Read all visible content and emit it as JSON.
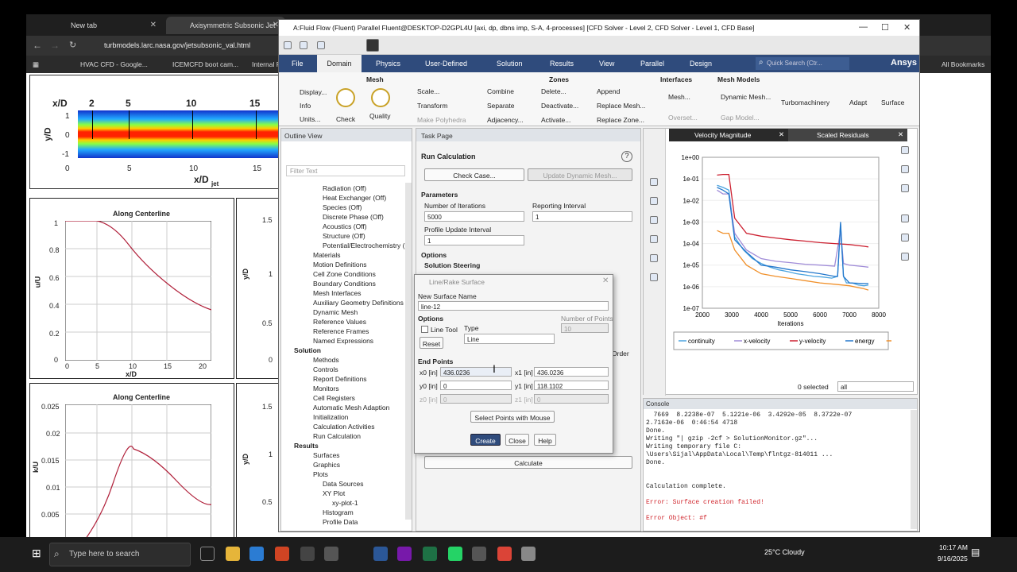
{
  "browser": {
    "tabs": [
      {
        "label": "New tab"
      },
      {
        "label": "Axisymmetric Subsonic Jet"
      }
    ],
    "url": "turbmodels.larc.nasa.gov/jetsubsonic_val.html",
    "bookmarks": [
      "HVAC CFD - Google...",
      "ICEMCFD boot cam...",
      "Internal F",
      "All Bookmarks"
    ]
  },
  "webpage": {
    "contour": {
      "xlabel": "x/D",
      "xsub": "jet",
      "ylabel": "y/D",
      "stations": [
        "x/D",
        "2",
        "5",
        "10",
        "15"
      ],
      "xticks": [
        "0",
        "5",
        "10",
        "15"
      ],
      "yticks": [
        "1",
        "0",
        "-1"
      ]
    },
    "plot1": {
      "title": "Along Centerline",
      "ylabel": "u/U",
      "ysub": "jet",
      "xlabel": "x/D",
      "xsub": "jet",
      "yticks": [
        "1",
        "0.8",
        "0.6",
        "0.4",
        "0.2",
        "0"
      ],
      "xticks": [
        "0",
        "5",
        "10",
        "15",
        "20"
      ]
    },
    "plot2": {
      "title": "Along Centerline",
      "ylabel": "k/U",
      "ysub": "jet",
      "yticks": [
        "0.025",
        "0.02",
        "0.015",
        "0.01",
        "0.005"
      ]
    },
    "plot3": {
      "ylabel": "y/D",
      "yticks": [
        "1.5",
        "1",
        "0.5",
        "0"
      ]
    },
    "plot4": {
      "ylabel": "y/D",
      "yticks": [
        "1.5",
        "1",
        "0.5"
      ]
    }
  },
  "fluent": {
    "title": "A:Fluid Flow (Fluent) Parallel Fluent@DESKTOP-D2GPL4U  [axi, dp, dbns imp, S-A, 4-processes] [CFD Solver - Level 2, CFD Solver - Level 1, CFD Base]",
    "menu": [
      "File",
      "Domain",
      "Physics",
      "User-Defined",
      "Solution",
      "Results",
      "View",
      "Parallel",
      "Design"
    ],
    "quick_search": "Quick Search (Ctr...",
    "brand": "Ansys",
    "ribbon": {
      "mesh_group": "Mesh",
      "zones_group": "Zones",
      "interfaces_group": "Interfaces",
      "mesh_models_group": "Mesh Models",
      "display": "Display...",
      "info": "Info",
      "units": "Units...",
      "check": "Check",
      "quality": "Quality",
      "scale": "Scale...",
      "transform": "Transform",
      "make_polyhedra": "Make Polyhedra",
      "combine": "Combine",
      "separate": "Separate",
      "adjacency": "Adjacency...",
      "delete": "Delete...",
      "deactivate": "Deactivate...",
      "activate": "Activate...",
      "append": "Append",
      "replace_mesh": "Replace Mesh...",
      "replace_zone": "Replace Zone...",
      "mesh_iface": "Mesh...",
      "overset": "Overset...",
      "dynamic_mesh": "Dynamic Mesh...",
      "gap_model": "Gap Model...",
      "turbomachinery": "Turbomachinery",
      "adapt": "Adapt",
      "surface": "Surface"
    },
    "outline": {
      "title": "Outline View",
      "filter": "Filter Text",
      "items": [
        "Radiation (Off)",
        "Heat Exchanger (Off)",
        "Species (Off)",
        "Discrete Phase (Off)",
        "Acoustics (Off)",
        "Structure (Off)",
        "Potential/Electrochemistry (Off)",
        "Materials",
        "Motion Definitions",
        "Cell Zone Conditions",
        "Boundary Conditions",
        "Mesh Interfaces",
        "Auxiliary Geometry Definitions",
        "Dynamic Mesh",
        "Reference Values",
        "Reference Frames",
        "Named Expressions",
        "Solution",
        "Methods",
        "Controls",
        "Report Definitions",
        "Monitors",
        "Cell Registers",
        "Automatic Mesh Adaption",
        "Initialization",
        "Calculation Activities",
        "Run Calculation",
        "Results",
        "Surfaces",
        "Graphics",
        "Plots",
        "Data Sources",
        "XY Plot",
        "xy-plot-1",
        "Histogram",
        "Profile Data"
      ]
    },
    "task": {
      "title": "Task Page",
      "heading": "Run Calculation",
      "check_case": "Check Case...",
      "update_dynamic_mesh": "Update Dynamic Mesh...",
      "parameters": "Parameters",
      "num_iter_label": "Number of Iterations",
      "num_iter": "5000",
      "reporting_label": "Reporting Interval",
      "reporting": "1",
      "profile_label": "Profile Update Interval",
      "profile": "1",
      "options": "Options",
      "solution_steering": "Solution Steering",
      "order": "Order",
      "calculate": "Calculate"
    },
    "dialog": {
      "title": "Line/Rake Surface",
      "new_name_label": "New Surface Name",
      "new_name": "line-12",
      "options": "Options",
      "line_tool": "Line Tool",
      "reset": "Reset",
      "type_label": "Type",
      "type": "Line",
      "num_points_label": "Number of Points",
      "num_points": "10",
      "end_points": "End Points",
      "x0_label": "x0 [in]",
      "x0": "436.0236",
      "x1_label": "x1 [in]",
      "x1": "436.0236",
      "y0_label": "y0 [in]",
      "y0": "0",
      "y1_label": "y1 [in]",
      "y1": "118.1102",
      "z0_label": "z0 [in]",
      "z0": "0",
      "z1_label": "z1 [in]",
      "z1": "0",
      "select_mouse": "Select Points with Mouse",
      "create": "Create",
      "close": "Close",
      "help": "Help"
    },
    "graphics": {
      "tab1": "Velocity Magnitude",
      "tab2": "Scaled Residuals",
      "selected": "0 selected",
      "filter": "all"
    },
    "console": {
      "title": "Console",
      "lines": [
        "  7669  8.2238e-07  5.1221e-06  3.4292e-05  8.3722e-07",
        "2.7163e-06  0:46:54 4718",
        "Done.",
        "Writing \"| gzip -2cf > SolutionMonitor.gz\"...",
        "Writing temporary file C:",
        "\\Users\\Sijal\\AppData\\Local\\Temp\\flntgz-814011 ...",
        "Done.",
        "",
        "Calculation complete.",
        "",
        "Error: Surface creation failed!",
        "",
        "Error Object: #f"
      ],
      "error_color": "#d0262d"
    }
  },
  "chart_data": {
    "type": "line",
    "title": "",
    "xlabel": "Iterations",
    "ylabel": "",
    "xlim": [
      2000,
      8000
    ],
    "ylim": [
      1e-07,
      1
    ],
    "yscale": "log",
    "xticks": [
      "2000",
      "3000",
      "4000",
      "5000",
      "6000",
      "7000",
      "8000"
    ],
    "yticks": [
      "1e+00",
      "1e-01",
      "1e-02",
      "1e-03",
      "1e-04",
      "1e-05",
      "1e-06",
      "1e-07"
    ],
    "legend_position": "bottom",
    "series": [
      {
        "name": "continuity",
        "color": "#4aa3df",
        "x": [
          2500,
          2700,
          2900,
          3100,
          3400,
          3700,
          4000,
          4300,
          4600,
          4900,
          5200,
          5500,
          5800,
          6100,
          6400,
          6600,
          6700,
          6800,
          6900,
          7100,
          7300,
          7500,
          7650
        ],
        "y": [
          0.05,
          0.04,
          0.03,
          0.0002,
          5e-05,
          2e-05,
          1.2e-05,
          8e-06,
          6e-06,
          5e-06,
          4e-06,
          3.5e-06,
          3e-06,
          2.8e-06,
          2.5e-06,
          3e-06,
          0.0008,
          3e-06,
          1.5e-06,
          1.5e-06,
          1.2e-06,
          1.1e-06,
          1.2e-06
        ]
      },
      {
        "name": "x-velocity",
        "color": "#a08cd8",
        "x": [
          2500,
          2700,
          2900,
          3100,
          3500,
          4000,
          4500,
          5000,
          5500,
          6000,
          6500,
          6700,
          6800,
          7000,
          7500,
          7650
        ],
        "y": [
          0.03,
          0.02,
          0.02,
          0.0003,
          5e-05,
          2e-05,
          1.5e-05,
          1.3e-05,
          1.1e-05,
          1e-05,
          9e-06,
          0.0004,
          1.2e-05,
          1e-05,
          8.5e-06,
          8e-06
        ]
      },
      {
        "name": "y-velocity",
        "color": "#cc2030",
        "x": [
          2500,
          2700,
          2900,
          3100,
          3500,
          4000,
          4500,
          5000,
          5500,
          6000,
          6500,
          7000,
          7500,
          7650
        ],
        "y": [
          0.15,
          0.16,
          0.16,
          0.0015,
          0.0003,
          0.00022,
          0.00018,
          0.00015,
          0.00013,
          0.00011,
          0.0001,
          9e-05,
          7.5e-05,
          7e-05
        ]
      },
      {
        "name": "energy",
        "color": "#2277cc",
        "x": [
          2500,
          2700,
          2900,
          3100,
          3500,
          4000,
          4500,
          5000,
          5500,
          6000,
          6500,
          6600,
          6700,
          6800,
          7000,
          7500,
          7650
        ],
        "y": [
          0.04,
          0.03,
          0.02,
          0.00015,
          4e-05,
          1e-05,
          8e-06,
          6e-06,
          5e-06,
          4e-06,
          3e-06,
          3e-06,
          0.001,
          3e-06,
          1.5e-06,
          1.4e-06,
          1.4e-06
        ]
      },
      {
        "name": "nut",
        "color": "#f0902a",
        "x": [
          2500,
          2700,
          2900,
          3100,
          3500,
          4000,
          4500,
          5000,
          5500,
          6000,
          6500,
          7000,
          7500,
          7650
        ],
        "y": [
          0.0004,
          0.0003,
          0.0003,
          5e-05,
          1e-05,
          4e-06,
          3e-06,
          2.4e-06,
          1.9e-06,
          1.5e-06,
          1.3e-06,
          1.1e-06,
          8e-07,
          7e-07
        ]
      }
    ]
  },
  "taskbar": {
    "search": "Type here to search",
    "weather": "25°C  Cloudy",
    "time": "10:17 AM",
    "date": "9/16/2025"
  }
}
